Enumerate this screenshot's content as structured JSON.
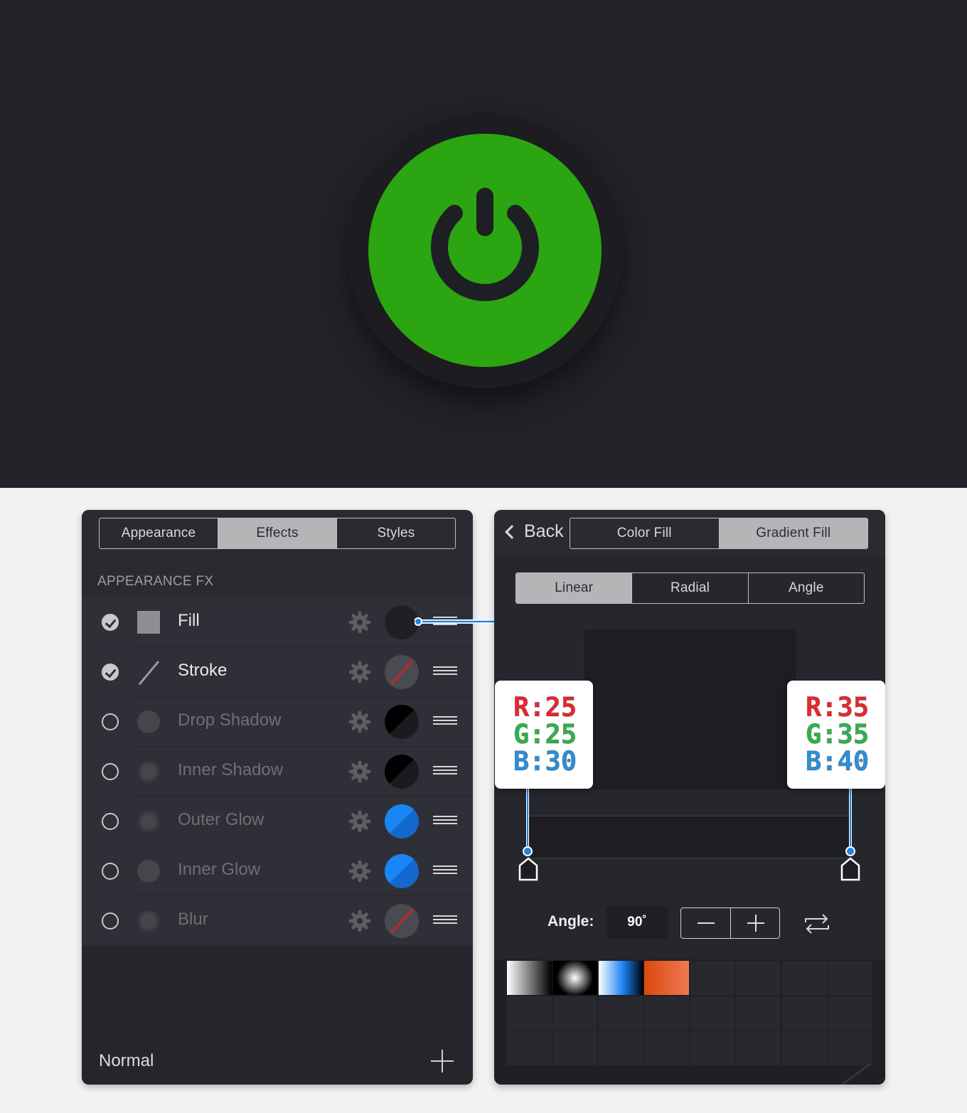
{
  "left_panel": {
    "tabs": [
      {
        "label": "Appearance",
        "active": false
      },
      {
        "label": "Effects",
        "active": true
      },
      {
        "label": "Styles",
        "active": false
      }
    ],
    "section_title": "APPEARANCE FX",
    "rows": [
      {
        "label": "Fill",
        "enabled": true,
        "swatch": "dark"
      },
      {
        "label": "Stroke",
        "enabled": true,
        "swatch": "none"
      },
      {
        "label": "Drop Shadow",
        "enabled": false,
        "swatch": "black"
      },
      {
        "label": "Inner Shadow",
        "enabled": false,
        "swatch": "black"
      },
      {
        "label": "Outer Glow",
        "enabled": false,
        "swatch": "blue"
      },
      {
        "label": "Inner Glow",
        "enabled": false,
        "swatch": "blue"
      },
      {
        "label": "Blur",
        "enabled": false,
        "swatch": "none"
      }
    ],
    "blend_mode": "Normal"
  },
  "right_panel": {
    "back_label": "Back",
    "fill_tabs": [
      {
        "label": "Color Fill",
        "active": false
      },
      {
        "label": "Gradient Fill",
        "active": true
      }
    ],
    "gradient_tabs": [
      {
        "label": "Linear",
        "active": true
      },
      {
        "label": "Radial",
        "active": false
      },
      {
        "label": "Angle",
        "active": false
      }
    ],
    "stops": [
      {
        "r": "R:25",
        "g": "G:25",
        "b": "B:30"
      },
      {
        "r": "R:35",
        "g": "G:35",
        "b": "B:40"
      }
    ],
    "angle_label": "Angle:",
    "angle_value": "90˚"
  },
  "colors": {
    "button_green": "#2ba511",
    "background": "#222228",
    "panel": "#2a2b31",
    "accent_blue": "#1e86e6"
  }
}
